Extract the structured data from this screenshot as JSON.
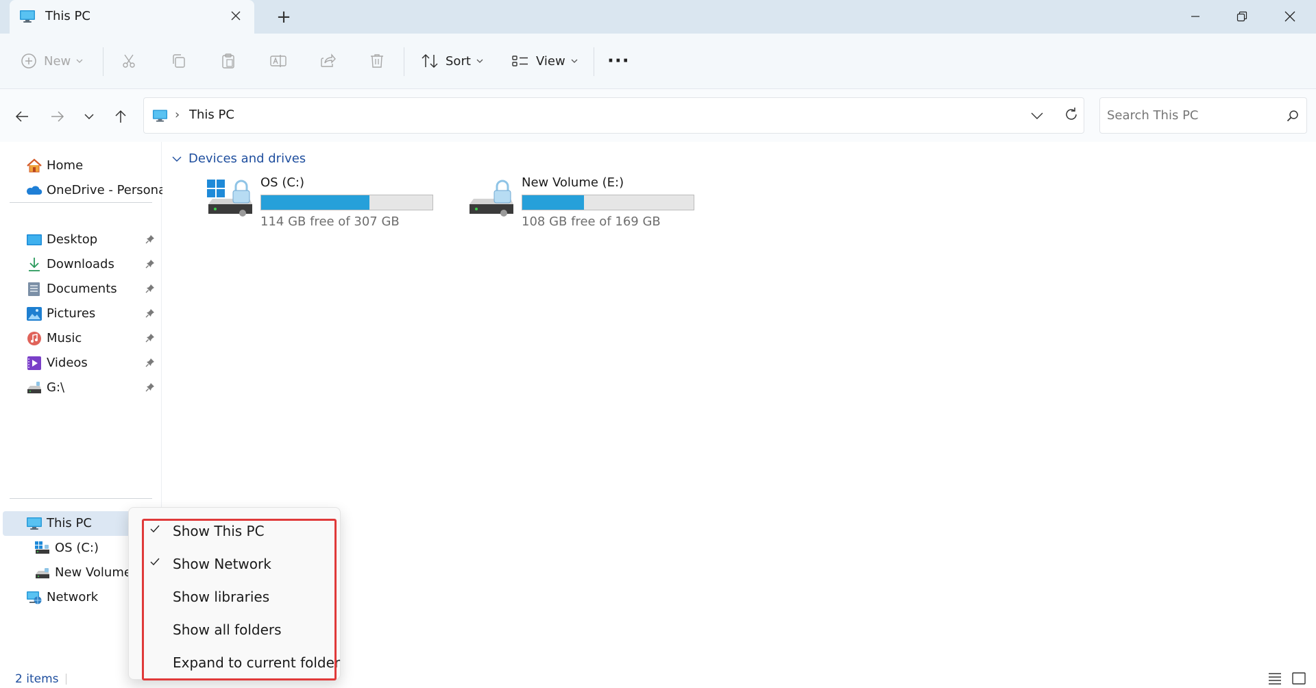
{
  "window": {
    "tab_title": "This PC",
    "new_tab_symbol": "+"
  },
  "toolbar": {
    "new_label": "New",
    "sort_label": "Sort",
    "view_label": "View",
    "more_label": "···"
  },
  "address": {
    "separator": "›",
    "crumb": "This PC"
  },
  "search": {
    "placeholder": "Search This PC"
  },
  "sidebar": {
    "top": [
      {
        "label": "Home",
        "icon": "home-icon"
      },
      {
        "label": "OneDrive - Personal",
        "icon": "onedrive-icon"
      }
    ],
    "pinned": [
      {
        "label": "Desktop",
        "icon": "desktop-icon"
      },
      {
        "label": "Downloads",
        "icon": "downloads-icon"
      },
      {
        "label": "Documents",
        "icon": "documents-icon"
      },
      {
        "label": "Pictures",
        "icon": "pictures-icon"
      },
      {
        "label": "Music",
        "icon": "music-icon"
      },
      {
        "label": "Videos",
        "icon": "videos-icon"
      },
      {
        "label": "G:\\",
        "icon": "drive-icon"
      }
    ],
    "tree": [
      {
        "label": "This PC",
        "icon": "this-pc-icon"
      },
      {
        "label": "OS (C:)",
        "icon": "os-drive-icon"
      },
      {
        "label": "New Volume",
        "icon": "volume-drive-icon"
      },
      {
        "label": "Network",
        "icon": "network-icon"
      }
    ]
  },
  "main": {
    "group_header": "Devices and drives",
    "drives": [
      {
        "name": "OS (C:)",
        "free_text": "114 GB free of 307 GB",
        "used_fraction": 0.63
      },
      {
        "name": "New Volume (E:)",
        "free_text": "108 GB free of 169 GB",
        "used_fraction": 0.36
      }
    ]
  },
  "status": {
    "items_text": "2 items"
  },
  "context_menu": {
    "items": [
      {
        "label": "Show This PC",
        "checked": true
      },
      {
        "label": "Show Network",
        "checked": true
      },
      {
        "label": "Show libraries",
        "checked": false
      },
      {
        "label": "Show all folders",
        "checked": false
      },
      {
        "label": "Expand to current folder",
        "checked": false
      }
    ]
  },
  "colors": {
    "accent": "#26a0da",
    "selection": "#dce7f3",
    "highlight_border": "#e03a3a",
    "link_blue": "#1e4e9e"
  }
}
